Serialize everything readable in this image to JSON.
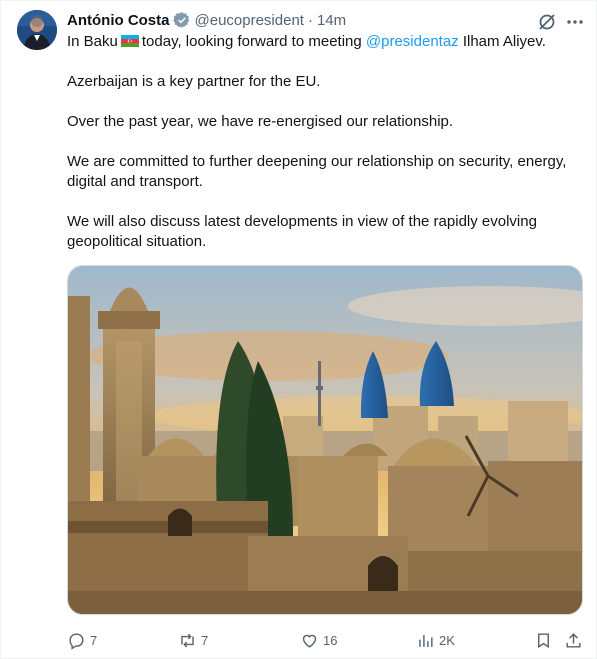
{
  "author": {
    "name": "António Costa",
    "handle": "@eucopresident",
    "separator": "·",
    "time": "14m"
  },
  "tweet": {
    "line1_prefix": "In Baku",
    "line1_middle": "today, looking forward to meeting",
    "mention": "@presidentaz",
    "line1_suffix": "Ilham Aliyev.",
    "p2": "Azerbaijan is a key partner for the EU.",
    "p3": "Over the past year, we have re-energised our relationship.",
    "p4": "We are committed to further deepening our relationship on security, energy, digital and transport.",
    "p5": "We will also discuss latest developments in view of the rapidly evolving geopolitical situation."
  },
  "actions": {
    "replies": "7",
    "reposts": "7",
    "likes": "16",
    "views": "2K"
  },
  "colors": {
    "text": "#0f1419",
    "secondary": "#536471",
    "link": "#1d9bf0",
    "border": "#cfd9de",
    "verified_badge": "#829aab"
  },
  "icons": [
    "verified-badge-icon",
    "grok-icon",
    "more-icon",
    "azerbaijan-flag-icon",
    "reply-icon",
    "repost-icon",
    "like-icon",
    "views-icon",
    "bookmark-icon",
    "share-icon"
  ]
}
